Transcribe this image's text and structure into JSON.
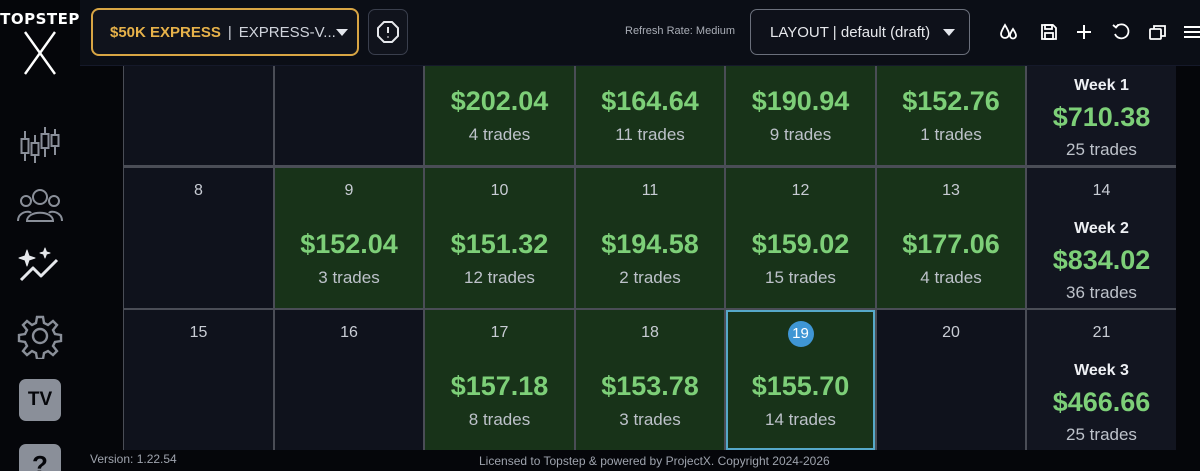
{
  "brand": {
    "logo_text": "TOPSTEP",
    "logo_mark": "X"
  },
  "sidebar": {
    "items": [
      {
        "icon": "candlestick-chart-icon"
      },
      {
        "icon": "users-group-icon"
      },
      {
        "icon": "analytics-sparkle-icon"
      },
      {
        "icon": "settings-gear-icon"
      },
      {
        "icon": "tradingview-icon",
        "label": "TV"
      },
      {
        "icon": "help-icon",
        "label": "?"
      }
    ]
  },
  "header": {
    "account": {
      "name": "$50K EXPRESS",
      "separator": "|",
      "id": "EXPRESS-V..."
    },
    "refresh_rate": "Refresh Rate: Medium",
    "layout": "LAYOUT | default (draft)",
    "accent_color": "#e7b24a"
  },
  "calendar": {
    "rows": [
      {
        "days": [
          {
            "day": "",
            "pnl": "",
            "trades": ""
          },
          {
            "day": "",
            "pnl": "",
            "trades": ""
          },
          {
            "day": "",
            "pnl": "$202.04",
            "trades": "4 trades"
          },
          {
            "day": "",
            "pnl": "$164.64",
            "trades": "11 trades"
          },
          {
            "day": "",
            "pnl": "$190.94",
            "trades": "9 trades"
          },
          {
            "day": "",
            "pnl": "$152.76",
            "trades": "1 trades"
          }
        ],
        "week": {
          "day": "",
          "label": "Week 1",
          "pnl": "$710.38",
          "trades": "25 trades"
        }
      },
      {
        "days": [
          {
            "day": "8",
            "pnl": "",
            "trades": ""
          },
          {
            "day": "9",
            "pnl": "$152.04",
            "trades": "3 trades"
          },
          {
            "day": "10",
            "pnl": "$151.32",
            "trades": "12 trades"
          },
          {
            "day": "11",
            "pnl": "$194.58",
            "trades": "2 trades"
          },
          {
            "day": "12",
            "pnl": "$159.02",
            "trades": "15 trades"
          },
          {
            "day": "13",
            "pnl": "$177.06",
            "trades": "4 trades"
          }
        ],
        "week": {
          "day": "14",
          "label": "Week 2",
          "pnl": "$834.02",
          "trades": "36 trades"
        }
      },
      {
        "days": [
          {
            "day": "15",
            "pnl": "",
            "trades": ""
          },
          {
            "day": "16",
            "pnl": "",
            "trades": ""
          },
          {
            "day": "17",
            "pnl": "$157.18",
            "trades": "8 trades"
          },
          {
            "day": "18",
            "pnl": "$153.78",
            "trades": "3 trades"
          },
          {
            "day": "19",
            "pnl": "$155.70",
            "trades": "14 trades",
            "today": true
          },
          {
            "day": "20",
            "pnl": "",
            "trades": ""
          }
        ],
        "week": {
          "day": "21",
          "label": "Week 3",
          "pnl": "$466.66",
          "trades": "25 trades"
        }
      }
    ],
    "colors": {
      "profit_text": "#7dcf78",
      "profit_cell": "#183319",
      "today_badge": "#3f96d4"
    }
  },
  "footer": {
    "version": "Version: 1.22.54",
    "license": "Licensed to Topstep & powered by ProjectX. Copyright 2024-2026"
  }
}
